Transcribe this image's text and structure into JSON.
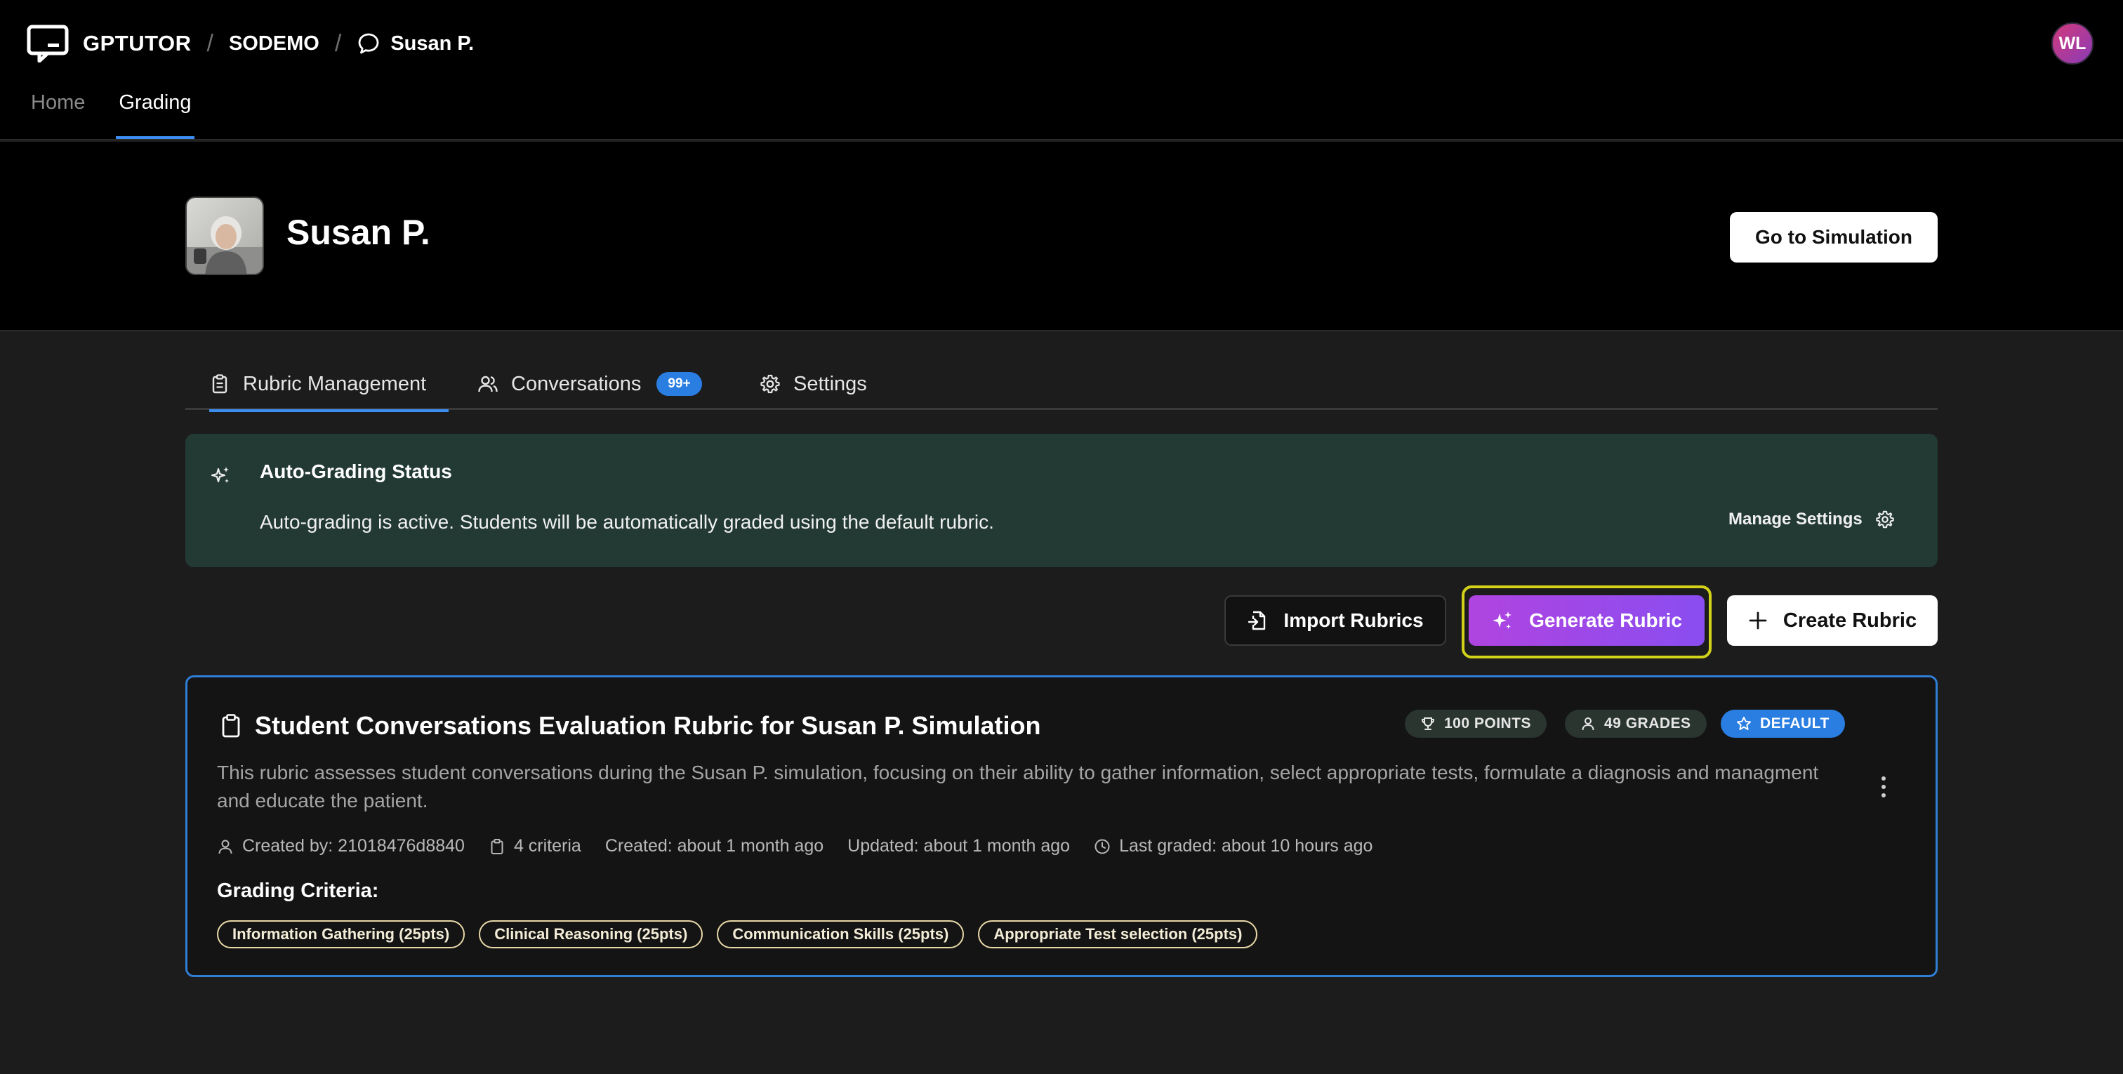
{
  "app": {
    "brand": "GPTUTOR",
    "breadcrumb": {
      "org": "SODEMO",
      "simulation": "Susan P."
    },
    "user_initials": "WL",
    "nav": [
      {
        "label": "Home",
        "active": false
      },
      {
        "label": "Grading",
        "active": true
      }
    ]
  },
  "header": {
    "title": "Susan P.",
    "go_to_simulation": "Go to Simulation"
  },
  "tabs": [
    {
      "label": "Rubric Management",
      "icon": "clipboard-icon",
      "active": true
    },
    {
      "label": "Conversations",
      "icon": "users-icon",
      "badge": "99+"
    },
    {
      "label": "Settings",
      "icon": "gear-icon"
    }
  ],
  "status": {
    "title": "Auto-Grading Status",
    "text": "Auto-grading is active. Students will be automatically graded using the default rubric.",
    "manage_settings": "Manage Settings"
  },
  "actions": {
    "import": "Import Rubrics",
    "generate": "Generate Rubric",
    "create": "Create Rubric"
  },
  "rubric": {
    "title": "Student Conversations Evaluation Rubric for Susan P. Simulation",
    "points": "100 POINTS",
    "grades": "49 GRADES",
    "default": "DEFAULT",
    "description": "This rubric assesses student conversations during the Susan P. simulation, focusing on their ability to gather information, select appropriate tests, formulate a diagnosis and managment and educate the patient.",
    "meta": {
      "created_by": "Created by: 21018476d8840",
      "criteria_count": "4 criteria",
      "created": "Created: about 1 month ago",
      "updated": "Updated: about 1 month ago",
      "last_graded": "Last graded: about 10 hours ago"
    },
    "criteria_label": "Grading Criteria:",
    "criteria": [
      "Information Gathering (25pts)",
      "Clinical Reasoning (25pts)",
      "Communication Skills (25pts)",
      "Appropriate Test selection (25pts)"
    ]
  },
  "colors": {
    "accent_blue": "#2a7de1",
    "status_bg": "#233a34",
    "generate_gradient_start": "#b044e0",
    "generate_gradient_end": "#8a4df0",
    "highlight_outline": "#d2d21a"
  }
}
